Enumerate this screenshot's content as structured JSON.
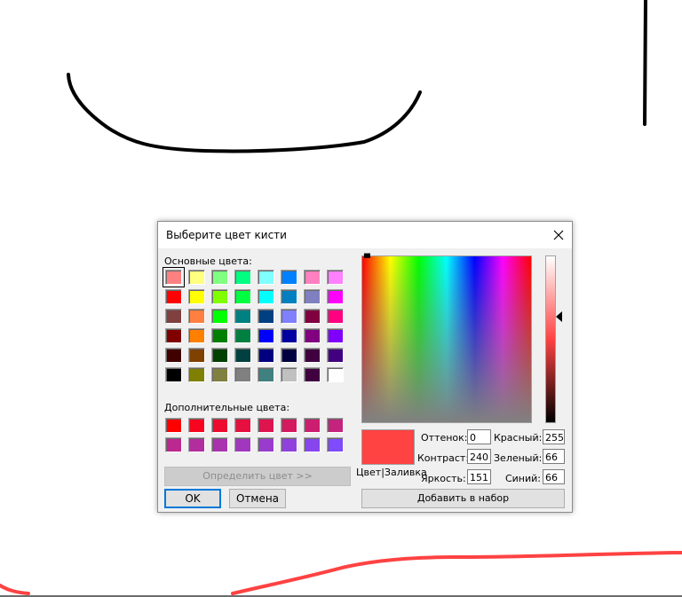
{
  "dialog": {
    "title": "Выберите цвет кисти",
    "basic_label": "Основные цвета:",
    "custom_label": "Дополнительные цвета:",
    "define_label": "Определить цвет >>",
    "ok_label": "OK",
    "cancel_label": "Отмена",
    "add_label": "Добавить в набор",
    "preview_label": "Цвет|Заливка",
    "selected_color": "#ff4242"
  },
  "fields": {
    "hue_label": "Оттенок:",
    "hue": "0",
    "sat_label": "Контраст:",
    "sat": "240",
    "lum_label": "Яркость:",
    "lum": "151",
    "red_label": "Красный:",
    "red": "255",
    "green_label": "Зеленый:",
    "green": "66",
    "blue_label": "Синий:",
    "blue": "66"
  },
  "basic_colors": [
    [
      "#ff8080",
      "#ffff80",
      "#80ff80",
      "#00ff80",
      "#80ffff",
      "#0080ff",
      "#ff80c0",
      "#ff80ff"
    ],
    [
      "#ff0000",
      "#ffff00",
      "#80ff00",
      "#00ff40",
      "#00ffff",
      "#0080c0",
      "#8080c0",
      "#ff00ff"
    ],
    [
      "#804040",
      "#ff8040",
      "#00ff00",
      "#008080",
      "#004080",
      "#8080ff",
      "#800040",
      "#ff0080"
    ],
    [
      "#800000",
      "#ff8000",
      "#008000",
      "#008040",
      "#0000ff",
      "#0000a0",
      "#800080",
      "#8000ff"
    ],
    [
      "#400000",
      "#804000",
      "#004000",
      "#004040",
      "#000080",
      "#000040",
      "#400040",
      "#400080"
    ],
    [
      "#000000",
      "#808000",
      "#808040",
      "#808080",
      "#408080",
      "#c0c0c0",
      "#400040",
      "#ffffff"
    ]
  ],
  "custom_colors": [
    [
      "#ff0000",
      "#f7051f",
      "#ee0a2f",
      "#e60f3f",
      "#dd144e",
      "#d5195e",
      "#cc1e6e",
      "#c4237e"
    ],
    [
      "#bb288e",
      "#b22d9e",
      "#aa32ae",
      "#a137be",
      "#993cce",
      "#9041dd",
      "#8746ed",
      "#7f4bfd"
    ]
  ],
  "canvas": {
    "stroke_black": "#000000",
    "stroke_red": "#ff4242"
  }
}
